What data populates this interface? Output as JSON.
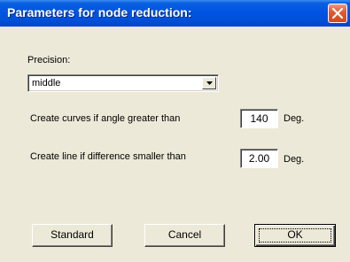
{
  "dialog": {
    "title": "Parameters for node reduction:"
  },
  "precision": {
    "label": "Precision:",
    "selected": "middle"
  },
  "curves": {
    "label": "Create curves if angle greater than",
    "value": "140",
    "unit": "Deg."
  },
  "line": {
    "label": "Create line if difference smaller than",
    "value": "2.00",
    "unit": "Deg."
  },
  "buttons": {
    "standard": "Standard",
    "cancel": "Cancel",
    "ok": "OK"
  },
  "colors": {
    "titlebar": "#0054e3",
    "close": "#e35a2f",
    "face": "#ece9d8"
  }
}
